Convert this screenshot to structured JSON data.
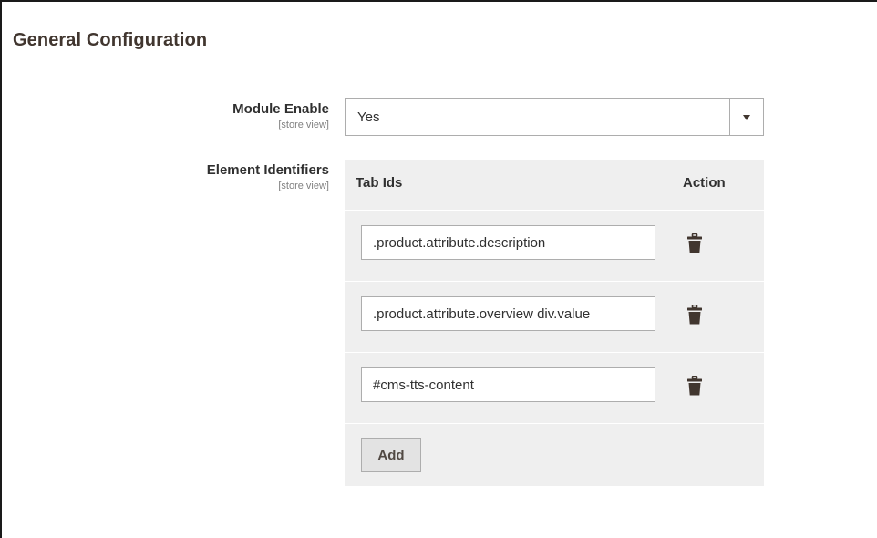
{
  "section": {
    "title": "General Configuration"
  },
  "module_enable": {
    "label": "Module Enable",
    "scope": "[store view]",
    "value": "Yes"
  },
  "element_identifiers": {
    "label": "Element Identifiers",
    "scope": "[store view]",
    "columns": {
      "tab_ids": "Tab Ids",
      "action": "Action"
    },
    "rows": [
      {
        "value": ".product.attribute.description",
        "delete_icon": "trash-icon"
      },
      {
        "value": ".product.attribute.overview div.value",
        "delete_icon": "trash-icon"
      },
      {
        "value": "#cms-tts-content",
        "delete_icon": "trash-icon"
      }
    ],
    "add_label": "Add"
  },
  "colors": {
    "title": "#41362f",
    "table_bg": "#efefef",
    "border": "#adadad",
    "button_bg": "#e3e3e3"
  }
}
